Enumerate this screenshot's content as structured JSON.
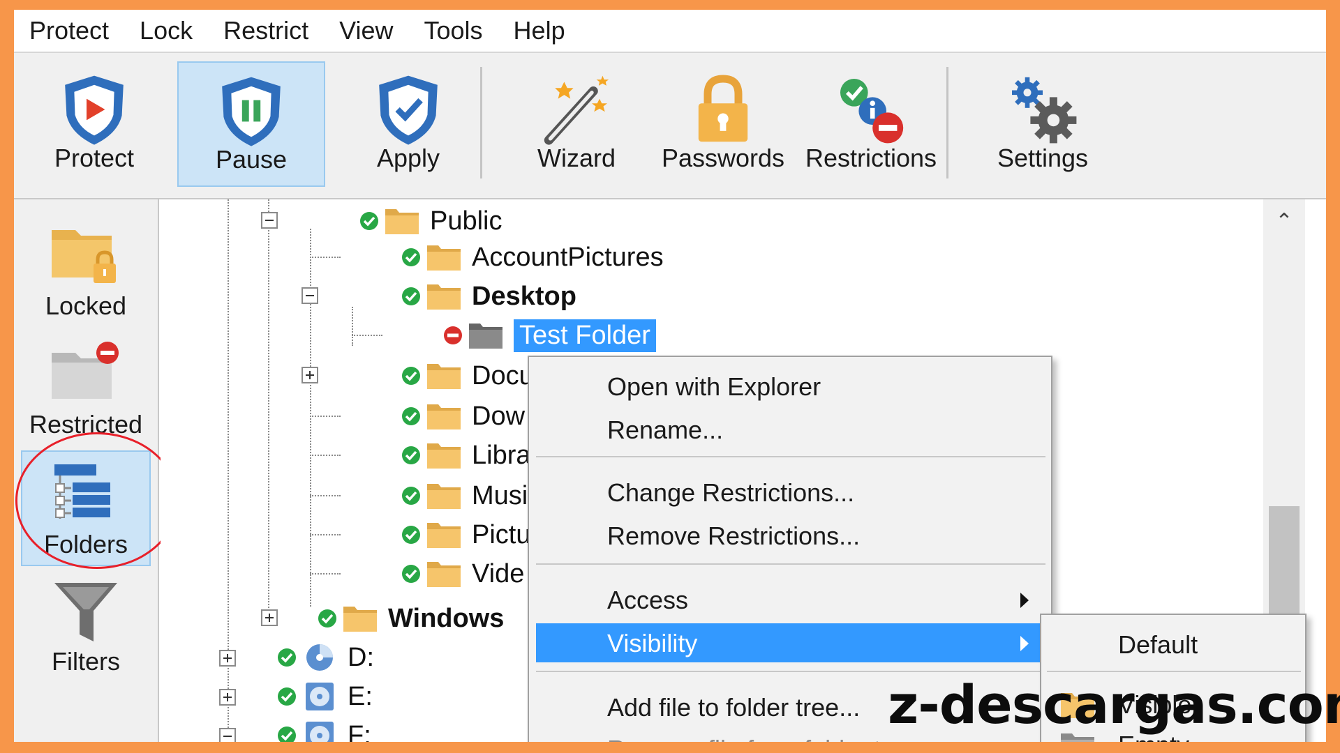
{
  "menubar": {
    "items": [
      "Protect",
      "Lock",
      "Restrict",
      "View",
      "Tools",
      "Help"
    ]
  },
  "toolbar": {
    "protect_label": "Protect",
    "pause_label": "Pause",
    "apply_label": "Apply",
    "wizard_label": "Wizard",
    "passwords_label": "Passwords",
    "restrictions_label": "Restrictions",
    "settings_label": "Settings",
    "active": "Pause"
  },
  "sidebar": {
    "items": [
      "Locked",
      "Restricted",
      "Folders",
      "Filters"
    ],
    "active": "Folders"
  },
  "tree": {
    "rows": [
      {
        "label": "Public",
        "status": "ok"
      },
      {
        "label": "AccountPictures",
        "status": "ok"
      },
      {
        "label": "Desktop",
        "status": "ok"
      },
      {
        "label": "Test Folder",
        "status": "restricted"
      },
      {
        "label": "Docu",
        "status": "ok"
      },
      {
        "label": "Dow",
        "status": "ok"
      },
      {
        "label": "Libra",
        "status": "ok"
      },
      {
        "label": "Musi",
        "status": "ok"
      },
      {
        "label": "Pictu",
        "status": "ok"
      },
      {
        "label": "Vide",
        "status": "ok"
      },
      {
        "label": "Windows",
        "status": "ok"
      },
      {
        "label": "D:",
        "status": "ok"
      },
      {
        "label": "E:",
        "status": "ok"
      },
      {
        "label": "F:",
        "status": "ok"
      }
    ]
  },
  "context_menu": {
    "open_explorer": "Open with Explorer",
    "rename": "Rename...",
    "change_restrictions": "Change Restrictions...",
    "remove_restrictions": "Remove Restrictions...",
    "access": "Access",
    "visibility": "Visibility",
    "add_file": "Add file to folder tree...",
    "remove_file": "Remove file from folder tree..."
  },
  "submenu": {
    "default": "Default",
    "visible": "Visible",
    "empty": "Empty"
  },
  "watermark": "z-descargas.com",
  "colors": {
    "frame": "#f7964a",
    "selection": "#3399ff",
    "active_button": "#cce4f7",
    "ok_green": "#28a745",
    "restricted_red": "#d9302c"
  }
}
